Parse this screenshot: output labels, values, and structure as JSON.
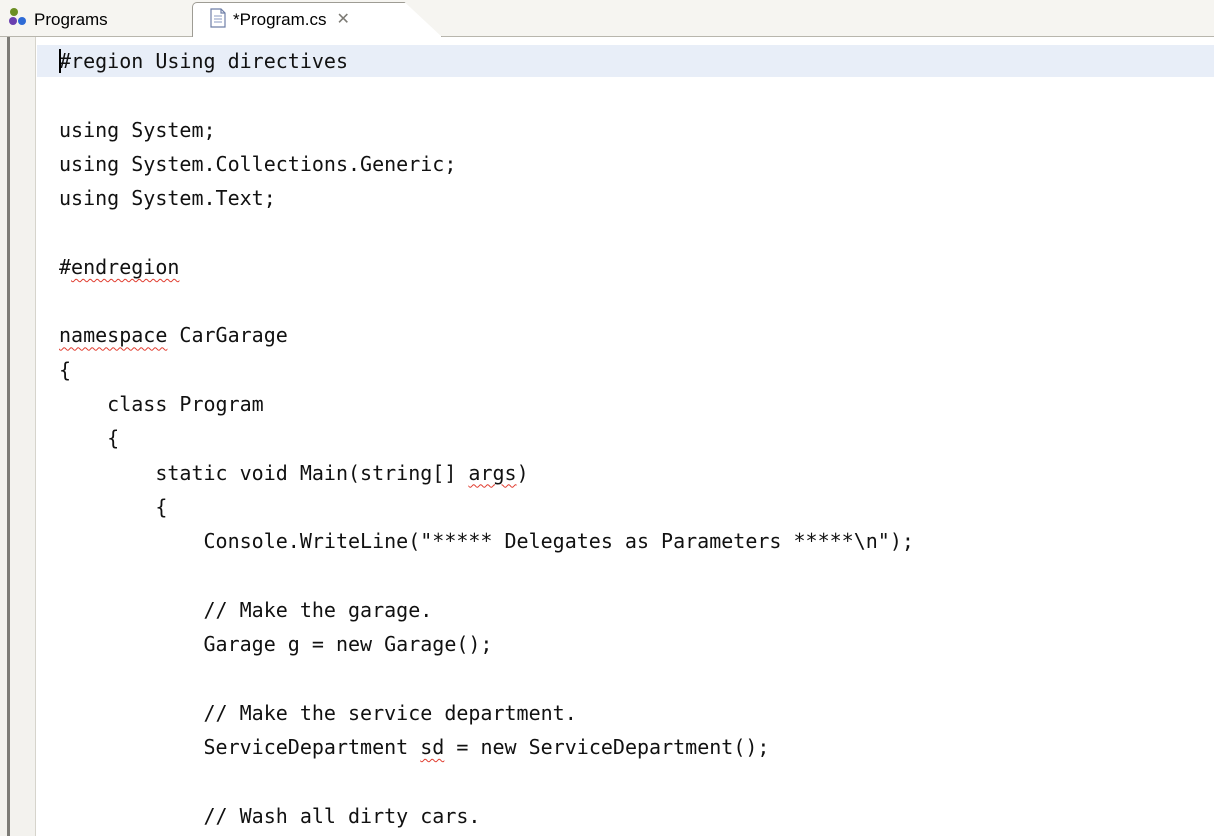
{
  "tabs": [
    {
      "label": "Programs",
      "icon": "programs-icon",
      "active": false
    },
    {
      "label": "*Program.cs",
      "icon": "file-icon",
      "active": true,
      "close_icon": "close-icon"
    }
  ],
  "editor": {
    "accent_colors": {
      "squiggle": "#e03b2e",
      "current_line": "#e8eef8"
    },
    "lines": [
      "#region Using directives",
      "",
      "using System;",
      "using System.Collections.Generic;",
      "using System.Text;",
      "",
      "#endregion",
      "",
      "namespace CarGarage",
      "{",
      "    class Program",
      "    {",
      "        static void Main(string[] args)",
      "        {",
      "            Console.WriteLine(\"***** Delegates as Parameters *****\\n\");",
      "",
      "            // Make the garage.",
      "            Garage g = new Garage();",
      "",
      "            // Make the service department.",
      "            ServiceDepartment sd = new ServiceDepartment();",
      "",
      "            // Wash all dirty cars."
    ],
    "squiggles": [
      {
        "line": 6,
        "word": "endregion"
      },
      {
        "line": 8,
        "word": "namespace"
      },
      {
        "line": 12,
        "word": "args"
      },
      {
        "line": 20,
        "word": "sd"
      }
    ]
  }
}
